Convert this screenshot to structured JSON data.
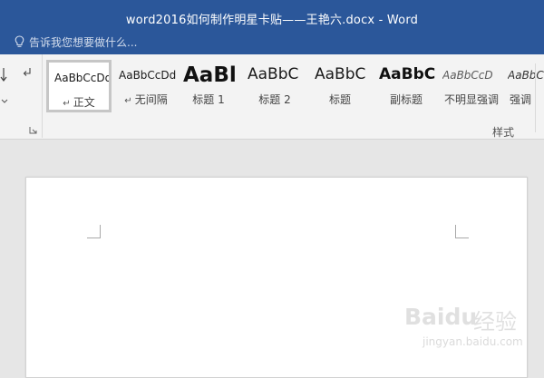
{
  "window": {
    "title": "word2016如何制作明星卡贴——王艳六.docx - Word",
    "tell_me_placeholder": "告诉我您想要做什么...",
    "accent": "#2b579a"
  },
  "ribbon": {
    "styles_group_label": "样式",
    "styles": [
      {
        "preview": "AaBbCcDd",
        "label": "正文",
        "has_mark": true,
        "selected": true
      },
      {
        "preview": "AaBbCcDd",
        "label": "无间隔",
        "has_mark": true,
        "selected": false
      },
      {
        "preview": "AaBl",
        "label": "标题 1",
        "has_mark": false,
        "selected": false
      },
      {
        "preview": "AaBbC",
        "label": "标题 2",
        "has_mark": false,
        "selected": false
      },
      {
        "preview": "AaBbC",
        "label": "标题",
        "has_mark": false,
        "selected": false
      },
      {
        "preview": "AaBbC",
        "label": "副标题",
        "has_mark": false,
        "selected": false
      },
      {
        "preview": "AaBbCcD",
        "label": "不明显强调",
        "has_mark": false,
        "selected": false
      },
      {
        "preview": "AaBbCcD",
        "label": "强调",
        "has_mark": false,
        "selected": false
      }
    ]
  },
  "watermark": {
    "brand": "Baidu",
    "brand_cn": "经验",
    "url": "jingyan.baidu.com"
  }
}
